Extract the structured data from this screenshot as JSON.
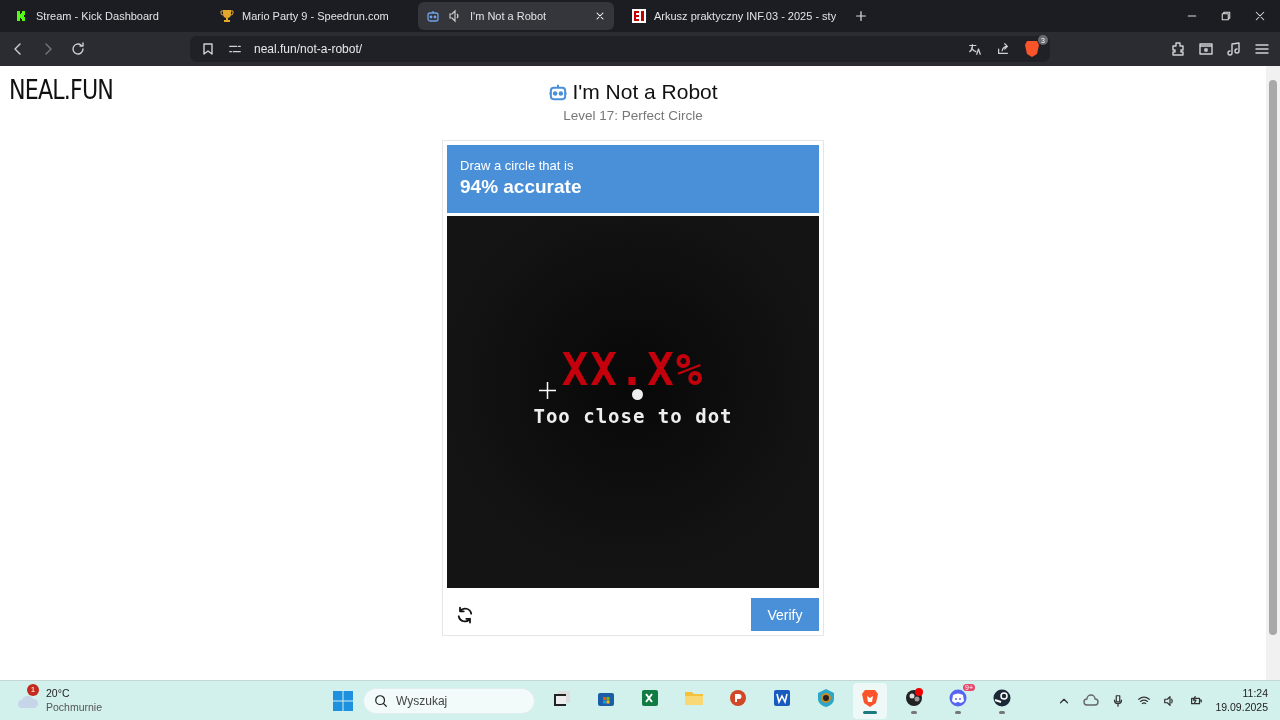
{
  "tabs": [
    {
      "title": "Stream - Kick Dashboard",
      "kind": "kick",
      "selected": false
    },
    {
      "title": "Mario Party 9 - Speedrun.com",
      "kind": "trophy",
      "selected": false
    },
    {
      "title": "I'm Not a Robot",
      "kind": "robot",
      "selected": true
    },
    {
      "title": "Arkusz praktyczny INF.03 - 2025 - sty",
      "kind": "ei",
      "selected": false
    }
  ],
  "address_bar": {
    "url_host": "neal.fun",
    "url_path": "/not-a-robot/"
  },
  "brave_shield_count": "3",
  "page": {
    "logo": "NEAL.FUN",
    "title": "I'm Not a Robot",
    "subtitle": "Level 17: Perfect Circle",
    "prompt": {
      "line1": "Draw a circle that is",
      "line2": "94% accurate"
    },
    "canvas": {
      "score": "XX.X%",
      "message": "Too close to dot"
    },
    "verify_button": "Verify"
  },
  "taskbar": {
    "weather": {
      "badge": "1",
      "temperature": "20°C",
      "condition": "Pochmurnie"
    },
    "search_placeholder": "Wyszukaj",
    "apps": [
      {
        "kind": "taskview",
        "running": false,
        "selected": false
      },
      {
        "kind": "store",
        "running": false,
        "selected": false
      },
      {
        "kind": "excel",
        "running": false,
        "selected": false
      },
      {
        "kind": "folder",
        "running": false,
        "selected": false
      },
      {
        "kind": "powerpoint",
        "running": false,
        "selected": false
      },
      {
        "kind": "word",
        "running": false,
        "selected": false
      },
      {
        "kind": "shield",
        "running": false,
        "selected": false
      },
      {
        "kind": "brave",
        "running": true,
        "selected": true
      },
      {
        "kind": "obs",
        "running": true,
        "selected": false
      },
      {
        "kind": "discord",
        "running": true,
        "selected": false,
        "badge": "9+"
      },
      {
        "kind": "steam",
        "running": true,
        "selected": false
      }
    ],
    "time": "11:24",
    "date": "19.09.2025"
  }
}
